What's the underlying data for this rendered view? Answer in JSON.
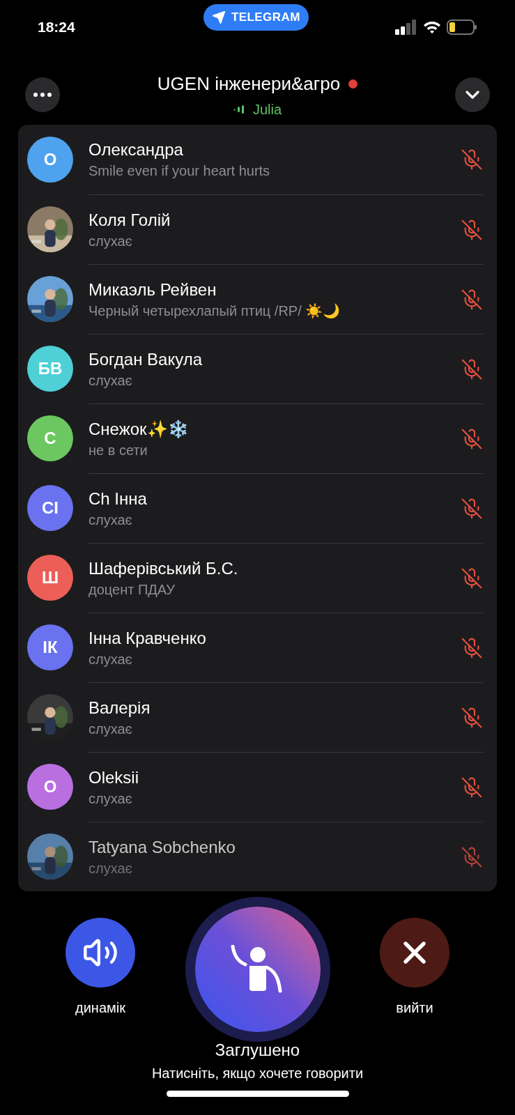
{
  "status_bar": {
    "time": "18:24",
    "app_pill": "TELEGRAM"
  },
  "header": {
    "title": "UGEN інженери&агро",
    "recording": true,
    "speaker": "Julia"
  },
  "participants": [
    {
      "name": "Олександра",
      "status": "Smile even if your heart hurts",
      "avatar": {
        "kind": "initials",
        "initials": "О",
        "color": "#4fa3ee"
      },
      "muted": true
    },
    {
      "name": "Коля Голій",
      "status": "слухає",
      "muted": true
    },
    {
      "name": "Микаэль Рейвен",
      "status": "Черный четырехлапый птиц /RP/ ☀️🌙",
      "muted": true
    },
    {
      "name": "Богдан Вакула",
      "status": "слухає",
      "avatar": {
        "kind": "initials",
        "initials": "БВ",
        "color": "#4fcfd6"
      },
      "muted": true
    },
    {
      "name": "Снежок✨❄️",
      "status": "не в сети",
      "avatar": {
        "kind": "initials",
        "initials": "С",
        "color": "#6cc760"
      },
      "muted": true
    },
    {
      "name": "Ch Інна",
      "status": "слухає",
      "avatar": {
        "kind": "initials",
        "initials": "CІ",
        "color": "#6a72f0"
      },
      "muted": true
    },
    {
      "name": "Шаферівський Б.С.",
      "status": "доцент ПДАУ",
      "avatar": {
        "kind": "initials",
        "initials": "Ш",
        "color": "#ec5f58"
      },
      "muted": true
    },
    {
      "name": "Інна Кравченко",
      "status": "слухає",
      "avatar": {
        "kind": "initials",
        "initials": "ІК",
        "color": "#6a72f0"
      },
      "muted": true
    },
    {
      "name": "Валерія",
      "status": "слухає",
      "muted": true
    },
    {
      "name": "Oleksii",
      "status": "слухає",
      "avatar": {
        "kind": "initials",
        "initials": "O",
        "color": "#b96fe0"
      },
      "muted": true
    },
    {
      "name": "Tatyana Sobchenko",
      "status": "слухає",
      "muted": true
    }
  ],
  "controls": {
    "speaker_label": "динамік",
    "leave_label": "вийти",
    "state": "Заглушено",
    "hint": "Натисніть, якщо хочете говорити"
  }
}
